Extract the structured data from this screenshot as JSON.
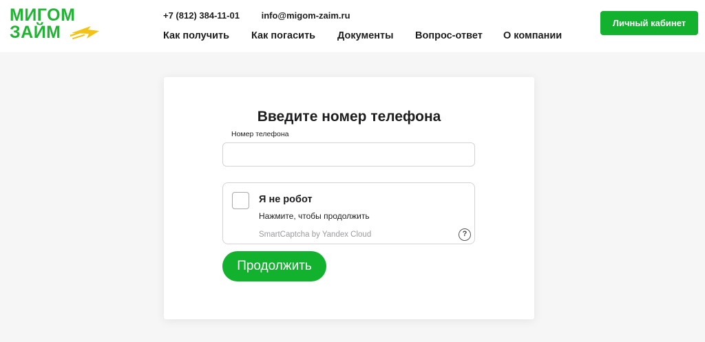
{
  "header": {
    "logo": {
      "line1": "МИГОМ",
      "line2": "ЗАЙМ"
    },
    "phone": "+7 (812) 384-11-01",
    "email": "info@migom-zaim.ru",
    "nav": [
      {
        "label": "Как получить"
      },
      {
        "label": "Как погасить"
      },
      {
        "label": "Документы"
      },
      {
        "label": "Вопрос-ответ"
      },
      {
        "label": "О компании"
      }
    ],
    "cabinet_button": "Личный кабинет"
  },
  "form": {
    "title": "Введите номер телефона",
    "phone_label": "Номер телефона",
    "phone_value": "",
    "captcha": {
      "title": "Я не робот",
      "subtitle": "Нажмите, чтобы продолжить",
      "brand": "SmartCaptcha by Yandex Cloud",
      "help_symbol": "?",
      "checked": false
    },
    "submit_label": "Продолжить"
  },
  "colors": {
    "brand_green": "#12b12e",
    "logo_green": "#1fb432",
    "logo_accent_yellow": "#f2c314",
    "page_background": "#f6f6f7",
    "text": "#1d1d1f",
    "muted_text": "#9a9aa0"
  },
  "icons": {
    "logo_arrow": "yellow-speed-arrow-icon",
    "help": "question-circle-icon"
  }
}
